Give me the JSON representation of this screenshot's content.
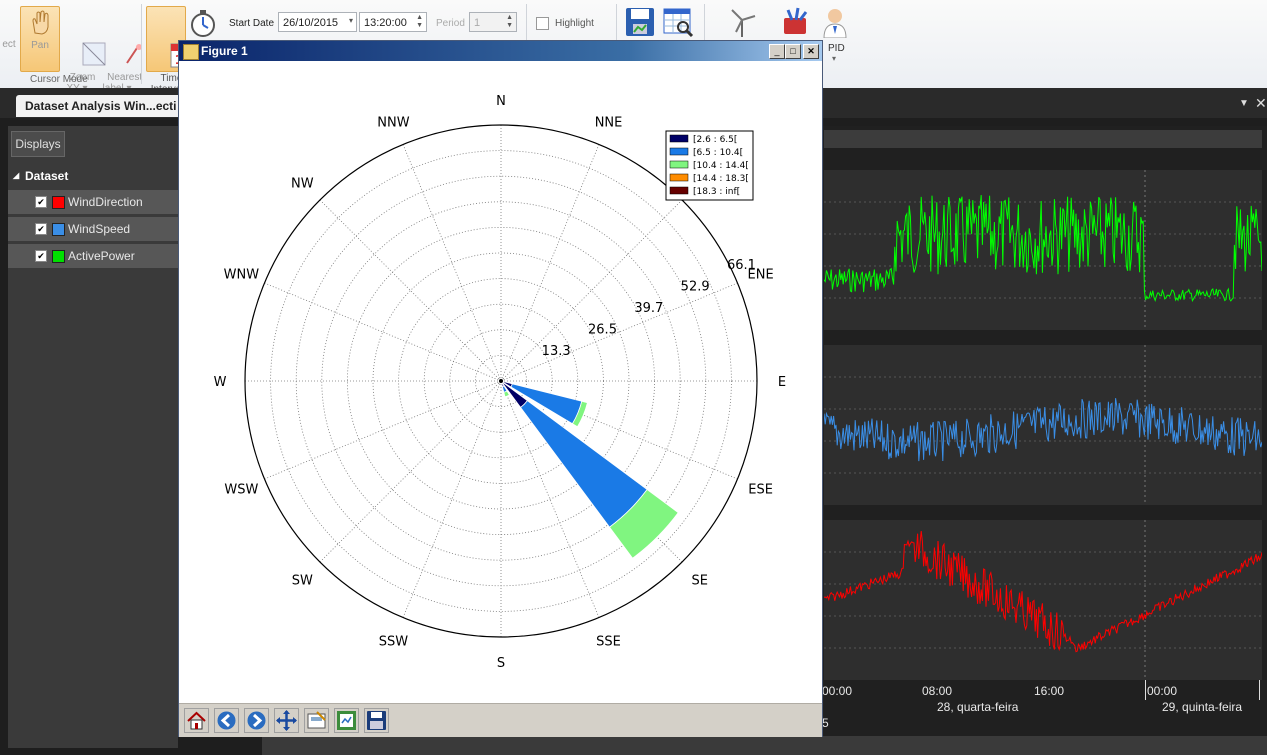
{
  "ribbon": {
    "tools": [
      {
        "label": "ect"
      },
      {
        "label": "Pan"
      },
      {
        "label": "Zoom\nXY ▾"
      },
      {
        "label": "Nearest\nlabel ▾"
      },
      {
        "label": "Time\nInterva"
      }
    ],
    "group_label": "Cursor Mode",
    "start_date_label": "Start Date",
    "start_date_value": "26/10/2015",
    "start_time_value": "13:20:00",
    "period_label": "Period",
    "period_value": "1",
    "highlight_label": "Highlight",
    "pid_label": "PID"
  },
  "app": {
    "tab_title": "Dataset Analysis Win...ecti",
    "displays_button": "Displays",
    "dataset_header": "Dataset",
    "dataset_items": [
      {
        "label": "WindDirection",
        "color": "#ff0000",
        "checked": true
      },
      {
        "label": "WindSpeed",
        "color": "#3a8ee6",
        "checked": true
      },
      {
        "label": "ActivePower",
        "color": "#00e000",
        "checked": true
      }
    ],
    "time_axis": {
      "ticks": [
        "00:00",
        "08:00",
        "16:00",
        "00:00"
      ],
      "dates": [
        "28, quarta-feira",
        "29, quinta-feira"
      ],
      "edge_label": "5"
    },
    "series_colors": {
      "active_power": "#00ff00",
      "wind_speed": "#3a8ee6",
      "wind_direction": "#ff0000"
    }
  },
  "figure": {
    "title": "Figure 1",
    "toolbar_icons": [
      "home-icon",
      "back-icon",
      "forward-icon",
      "pan-icon",
      "subplots-icon",
      "zoom-icon",
      "save-icon"
    ]
  },
  "chart_data": {
    "type": "windrose",
    "directions": [
      "N",
      "NNE",
      "NE",
      "ENE",
      "E",
      "ESE",
      "SE",
      "SSE",
      "S",
      "SSW",
      "SW",
      "WSW",
      "W",
      "WNW",
      "NW",
      "NNW"
    ],
    "radial_ticks": [
      13.3,
      26.5,
      39.7,
      52.9,
      66.1
    ],
    "rmax": 66.1,
    "legend": [
      {
        "label": "[2.6 : 6.5[",
        "color": "#000066"
      },
      {
        "label": "[6.5 : 10.4[",
        "color": "#1a7ae6"
      },
      {
        "label": "[10.4 : 14.4[",
        "color": "#80f580"
      },
      {
        "label": "[14.4 : 18.3[",
        "color": "#ff8c00"
      },
      {
        "label": "[18.3 : inf[",
        "color": "#660000"
      }
    ],
    "bars": [
      {
        "direction": "ESE",
        "segments": [
          3.0,
          18.5,
          1.5
        ]
      },
      {
        "direction": "SE",
        "segments": [
          8.5,
          38.5,
          10.0
        ]
      },
      {
        "direction": "SSE",
        "segments": [
          1.5,
          1.5,
          1.2
        ]
      }
    ]
  }
}
